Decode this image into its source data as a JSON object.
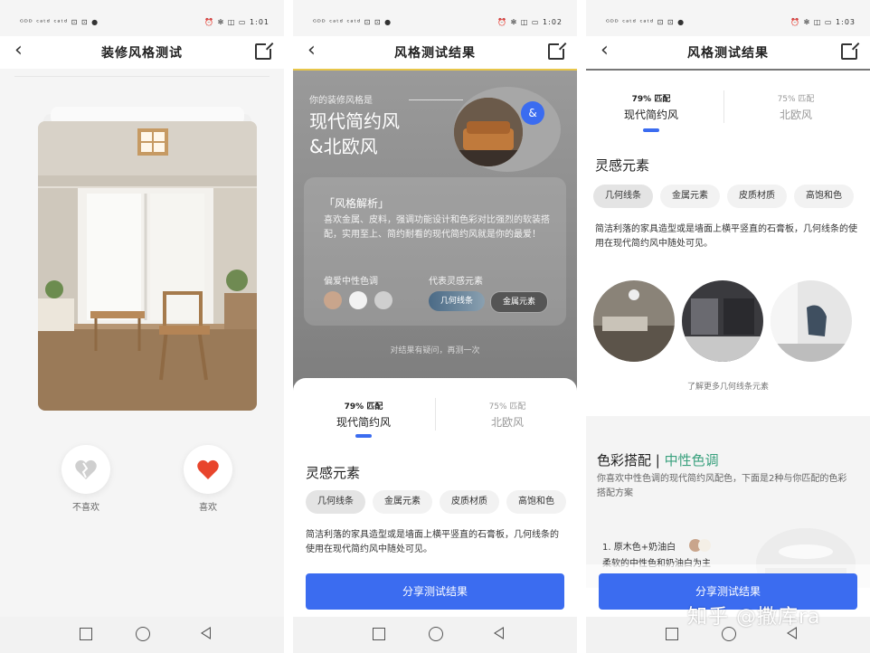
{
  "status_bar": {
    "left": "ᴳᴰᴰ ᶜᵃᵗᵈ ᶜᵃᵗᵈ ⊡ ⊡ ●",
    "right_p1": "⏰ ✻ ◫ ▭ 1:01",
    "right_p2": "⏰ ✻ ◫ ▭ 1:02",
    "right_p3": "⏰ ✻ ◫ ▭ 1:03"
  },
  "screen1": {
    "title": "装修风格测试",
    "dislike_label": "不喜欢",
    "like_label": "喜欢"
  },
  "screen2": {
    "title": "风格测试结果",
    "result_label": "你的装修风格是",
    "result_line1": "现代简约风",
    "result_line2": "&北欧风",
    "badge": "&",
    "analysis_title": "「风格解析」",
    "analysis_text": "喜欢金属、皮料，强调功能设计和色彩对比强烈的软装搭配，实用至上、简约耐看的现代简约风就是你的最爱！",
    "preferred_tones_label": "偏爱中性色调",
    "inspiration_label": "代表灵感元素",
    "tone_colors": [
      "#c9a58c",
      "#f2f2f2",
      "#cfcfcf"
    ],
    "element_tags": [
      "几何线条",
      "金属元素"
    ],
    "retry_text": "对结果有疑问，再测一次"
  },
  "tabs": [
    {
      "pct": "79% 匹配",
      "name": "现代简约风"
    },
    {
      "pct": "75% 匹配",
      "name": "北欧风"
    }
  ],
  "section_inspiration": "灵感元素",
  "chips": [
    "几何线条",
    "金属元素",
    "皮质材质",
    "高饱和色"
  ],
  "inspiration_desc": "简洁利落的家具造型或是墙面上横平竖直的石膏板，几何线条的使用在现代简约风中随处可见。",
  "screen3": {
    "title": "风格测试结果",
    "more_link": "了解更多几何线条元素",
    "color_title_main": "色彩搭配",
    "color_title_sep": " | ",
    "color_title_accent": "中性色调",
    "color_desc": "你喜欢中性色调的现代简约风配色，下面是2种与你匹配的色彩搭配方案",
    "option1": "1. 原木色+奶油白",
    "option1_sub": "柔软的中性色和奶油白为主"
  },
  "share_button": "分享测试结果",
  "watermark": "知乎 @撒库ra",
  "colors": {
    "accent": "#3b6cf0",
    "green": "#3aa17e",
    "yellow_line": "#e8c64a"
  }
}
